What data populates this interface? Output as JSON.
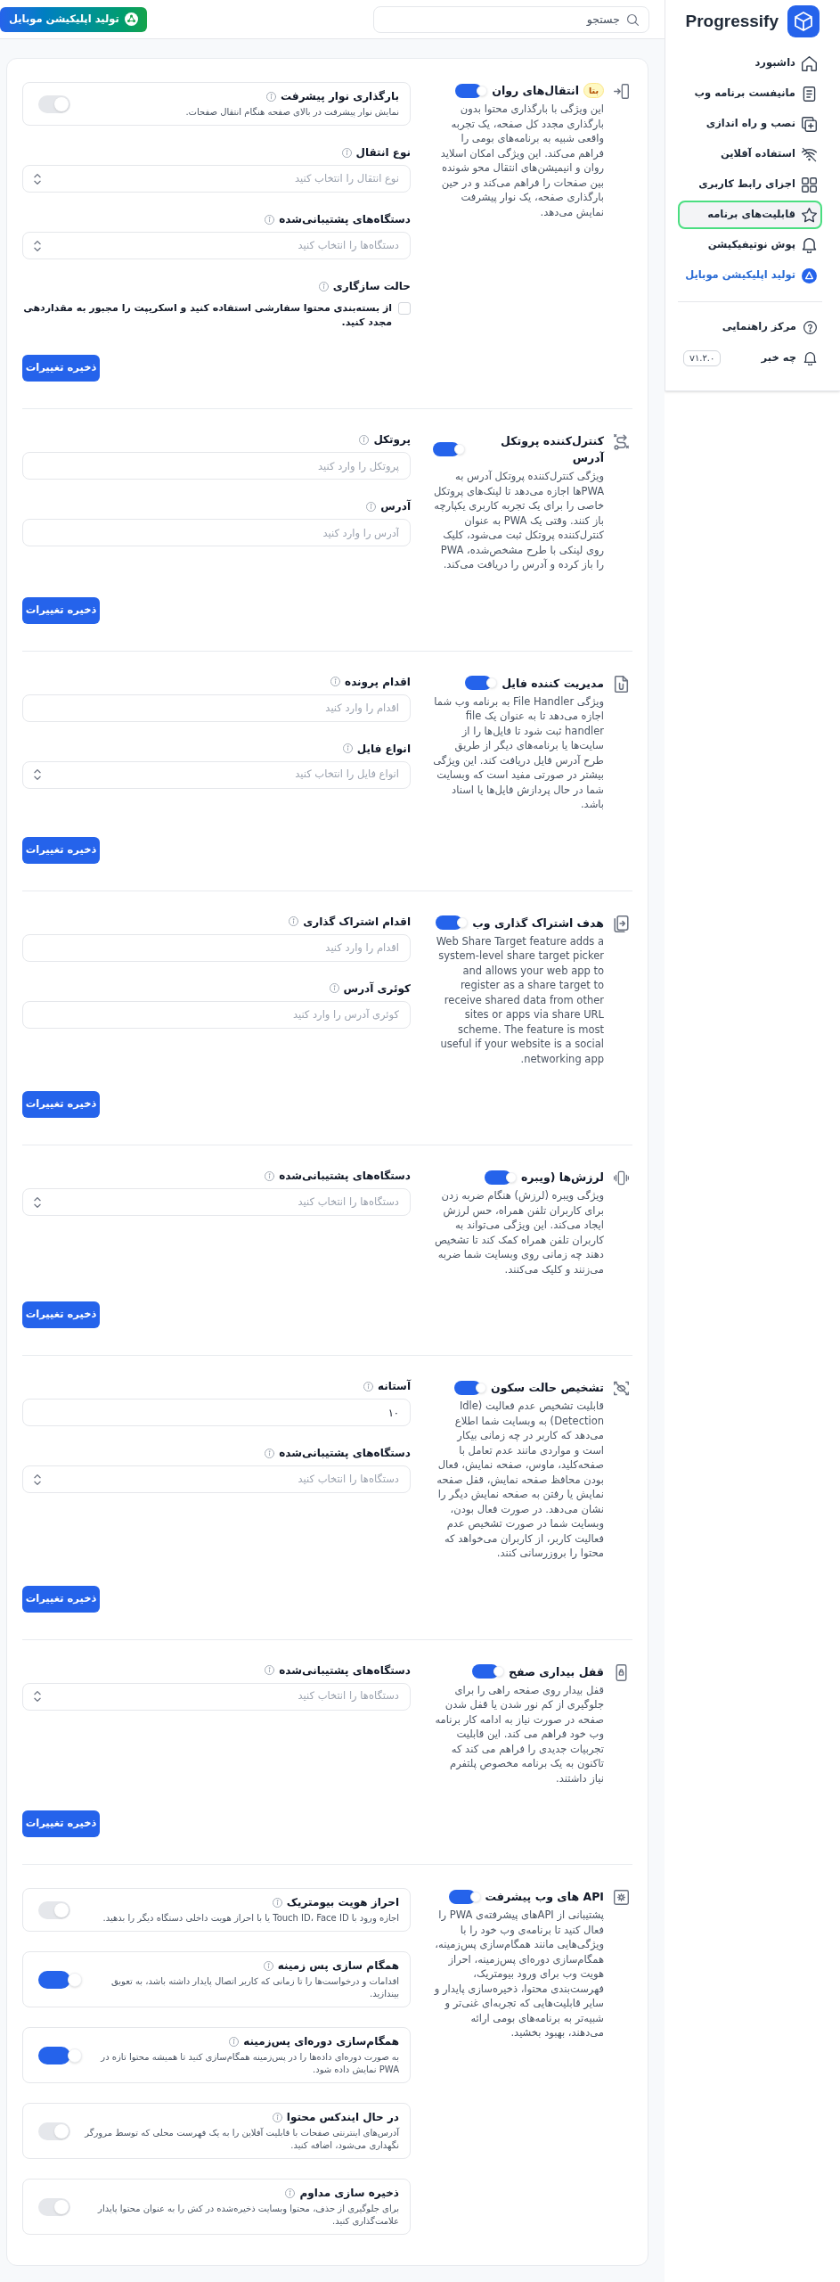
{
  "header": {
    "search": {
      "placeholder": "جستجو"
    },
    "action_button": "تولید اپلیکیشن موبایل"
  },
  "sidebar": {
    "brand": "Progressify",
    "items": [
      {
        "label": "داشبورد",
        "kind": "nav",
        "selected": false
      },
      {
        "label": "مانیفست برنامه وب",
        "kind": "nav",
        "selected": false
      },
      {
        "label": "نصب و راه اندازی",
        "kind": "nav",
        "selected": false
      },
      {
        "label": "استفاده آفلاین",
        "kind": "nav",
        "selected": false
      },
      {
        "label": "اجزای رابط کاربری",
        "kind": "nav",
        "selected": false
      },
      {
        "label": "قابلیت‌های برنامه",
        "kind": "nav",
        "selected": true
      },
      {
        "label": "پوش نوتیفیکیشن",
        "kind": "nav",
        "selected": false
      },
      {
        "label": "تولید اپلیکیشن موبایل",
        "kind": "promo",
        "selected": false
      }
    ],
    "footer_items": [
      {
        "label": "مرکز راهنمایی"
      },
      {
        "label": "چه خبر",
        "badge": "v۱.۲.۰"
      }
    ]
  },
  "sections": [
    {
      "title": "انتقال‌های روان",
      "badge": "بتا",
      "enabled": true,
      "description": "این ویژگی با بارگذاری محتوا بدون بارگذاری مجدد کل صفحه، یک تجربه واقعی شبیه به برنامه‌های بومی را فراهم می‌کند. این ویژگی امکان اسلاید روان و انیمیشن‌های انتقال محو شونده بین صفحات را فراهم می‌کند و در حین بارگذاری صفحه، یک نوار پیشرفت نمایش می‌دهد.",
      "fields": [
        {
          "kind": "switch",
          "label": "بارگذاری نوار پیشرفت",
          "description": "نمایش نوار پیشرفت در بالای صفحه هنگام انتقال صفحات.",
          "on": false
        },
        {
          "kind": "select",
          "label": "نوع انتقال",
          "placeholder": "نوع انتقال را انتخاب کنید"
        },
        {
          "kind": "select",
          "label": "دستگاه‌های پشتیبانی‌شده",
          "placeholder": "دستگاه‌ها را انتخاب کنید"
        },
        {
          "kind": "checkbox",
          "label": "حالت سازگاری",
          "text": "از بسته‌بندی محتوا سفارشی استفاده کنید و اسکریپت را مجبور به مقداردهی مجدد کنید.",
          "checked": false
        }
      ],
      "save_button": "ذخیره تغییرات"
    },
    {
      "title": "کنترل‌کننده پروتکل آدرس",
      "enabled": true,
      "description": "ویژگی کنترل‌کننده پروتکل آدرس به PWAها اجازه می‌دهد تا لینک‌های پروتکل خاصی را برای یک تجربه کاربری یکپارچه باز کنند. وقتی یک PWA به عنوان کنترل‌کننده پروتکل ثبت می‌شود، کلیک روی لینکی با طرح مشخص‌شده، PWA را باز کرده و آدرس را دریافت می‌کند.",
      "fields": [
        {
          "kind": "text",
          "label": "پروتکل",
          "placeholder": "پروتکل را وارد کنید"
        },
        {
          "kind": "text",
          "label": "آدرس",
          "placeholder": "آدرس را وارد کنید"
        }
      ],
      "save_button": "ذخیره تغییرات"
    },
    {
      "title": "مدیریت کننده فایل",
      "enabled": true,
      "description": "ویژگی File Handler به برنامه وب شما اجازه می‌دهد تا به عنوان یک file handler ثبت شود تا فایل‌ها را از سایت‌ها یا برنامه‌های دیگر از طریق طرح آدرس فایل دریافت کند. این ویژگی بیشتر در صورتی مفید است که وبسایت شما در حال پردازش فایل‌ها یا اسناد باشد.",
      "fields": [
        {
          "kind": "text",
          "label": "اقدام پرونده",
          "placeholder": "اقدام را وارد کنید"
        },
        {
          "kind": "select",
          "label": "انواع فایل",
          "placeholder": "انواع فایل را انتخاب کنید"
        }
      ],
      "save_button": "ذخیره تغییرات"
    },
    {
      "title": "هدف اشتراک گذاری وب",
      "enabled": true,
      "description": "Web Share Target feature adds a system-level share target picker and allows your web app to register as a share target to receive shared data from other sites or apps via share URL scheme. The feature is most useful if your website is a social networking app.",
      "fields": [
        {
          "kind": "text",
          "label": "اقدام اشتراک گذاری",
          "placeholder": "اقدام را وارد کنید"
        },
        {
          "kind": "text",
          "label": "کوئری آدرس",
          "placeholder": "کوئری آدرس را وارد کنید"
        }
      ],
      "save_button": "ذخیره تغییرات"
    },
    {
      "title": "لرزش‌ها (ویبره",
      "enabled": true,
      "description": "ویژگی ویبره (لرزش) هنگام ضربه زدن برای کاربران تلفن همراه، حس لرزش ایجاد می‌کند. این ویژگی می‌تواند به کاربران تلفن همراه کمک کند تا تشخیص دهند چه زمانی روی وبسایت شما ضربه می‌زنند و کلیک می‌کنند.",
      "fields": [
        {
          "kind": "select",
          "label": "دستگاه‌های پشتیبانی‌شده",
          "placeholder": "دستگاه‌ها را انتخاب کنید"
        }
      ],
      "save_button": "ذخیره تغییرات"
    },
    {
      "title": "تشخیص حالت سکون",
      "enabled": true,
      "description": "قابلیت تشخیص عدم فعالیت (Idle Detection) به وبسایت شما اطلاع می‌دهد که کاربر در چه زمانی بیکار است و مواردی مانند عدم تعامل با صفحه‌کلید، ماوس، صفحه نمایش، فعال بودن محافظ صفحه نمایش، قفل صفحه نمایش یا رفتن به صفحه نمایش دیگر را نشان می‌دهد. در صورت فعال بودن، وبسایت شما در صورت تشخیص عدم فعالیت کاربر، از کاربران می‌خواهد که محتوا را بروزرسانی کنند.",
      "fields": [
        {
          "kind": "text",
          "label": "آستانه",
          "value": "۱۰"
        },
        {
          "kind": "select",
          "label": "دستگاه‌های پشتیبانی‌شده",
          "placeholder": "دستگاه‌ها را انتخاب کنید"
        }
      ],
      "save_button": "ذخیره تغییرات"
    },
    {
      "title": "قفل بیداری صفح",
      "enabled": true,
      "description": "قفل بیدار روی صفحه راهی را برای جلوگیری از کم نور شدن یا قفل شدن صفحه در صورت نیاز به ادامه کار برنامه وب خود فراهم می کند. این قابلیت تجربیات جدیدی را فراهم می کند که تاکنون به یک برنامه مخصوص پلتفرم نیاز داشتند.",
      "fields": [
        {
          "kind": "select",
          "label": "دستگاه‌های پشتیبانی‌شده",
          "placeholder": "دستگاه‌ها را انتخاب کنید"
        }
      ],
      "save_button": "ذخیره تغییرات"
    },
    {
      "title": "API های وب پیشرفت",
      "enabled": true,
      "description": "پشتیبانی از APIهای پیشرفته‌ی PWA را فعال کنید تا برنامه‌ی وب خود را با ویژگی‌هایی مانند همگام‌سازی پس‌زمینه، همگام‌سازی دوره‌ای پس‌زمینه، احراز هویت وب برای ورود بیومتریک، فهرست‌بندی محتوا، ذخیره‌سازی پایدار و سایر قابلیت‌هایی که تجربه‌ای غنی‌تر و شبیه‌تر به برنامه‌های بومی ارائه می‌دهند، بهبود بخشید.",
      "fields": [
        {
          "kind": "switch",
          "label": "احراز هویت بیومتریک",
          "description": "اجازه ورود با Touch ID، Face ID یا با احراز هویت داخلی دستگاه دیگر را بدهید.",
          "on": false
        },
        {
          "kind": "switch",
          "label": "همگام سازی پس زمینه",
          "description": "اقدامات و درخواست‌ها را تا زمانی که کاربر اتصال پایدار داشته باشد، به تعویق بیندازید.",
          "on": true
        },
        {
          "kind": "switch",
          "label": "همگام‌سازی دوره‌ای پس‌زمینه",
          "description": "به صورت دوره‌ای داده‌ها را در پس‌زمینه همگام‌سازی کنید تا همیشه محتوا تازه در PWA نمایش داده شود.",
          "on": true
        },
        {
          "kind": "switch",
          "label": "در حال ایندکس محتوا",
          "description": "آدرس‌های اینترنتی صفحات با قابلیت آفلاین را به یک فهرست محلی که توسط مرورگر نگهداری می‌شود، اضافه کنید.",
          "on": false
        },
        {
          "kind": "switch",
          "label": "ذخیره سازی مداوم",
          "description": "برای جلوگیری از حذف، محتوا وبسایت ذخیره‌شده در کش را به عنوان محتوا پایدار علامت‌گذاری کنید.",
          "on": false
        }
      ]
    }
  ]
}
